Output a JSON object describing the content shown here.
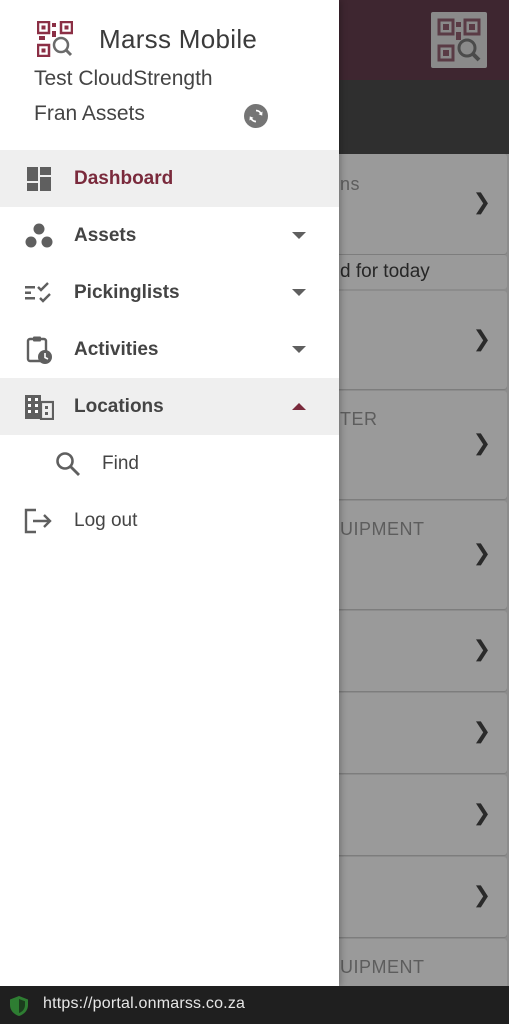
{
  "drawer": {
    "app_title": "Marss Mobile",
    "account_name": "Test CloudStrength",
    "account_sub": "Fran Assets",
    "menu": [
      {
        "label": "Dashboard",
        "icon": "dashboard-icon",
        "state": "active"
      },
      {
        "label": "Assets",
        "icon": "assets-icon",
        "expand": "collapsed"
      },
      {
        "label": "Pickinglists",
        "icon": "checklist-icon",
        "expand": "collapsed"
      },
      {
        "label": "Activities",
        "icon": "clipboard-clock-icon",
        "expand": "collapsed"
      },
      {
        "label": "Locations",
        "icon": "building-icon",
        "expand": "expanded"
      },
      {
        "label": "Find",
        "icon": "search-icon"
      },
      {
        "label": "Log out",
        "icon": "logout-icon"
      }
    ]
  },
  "background": {
    "peek_texts": [
      "ns",
      "d for today",
      "TER",
      "UIPMENT",
      "UIPMENT"
    ]
  },
  "urlbar": {
    "url": "https://portal.onmarss.co.za"
  },
  "colors": {
    "accent": "#7a2a3c",
    "topbar": "#4a2a38",
    "shield": "#2e7d32"
  }
}
